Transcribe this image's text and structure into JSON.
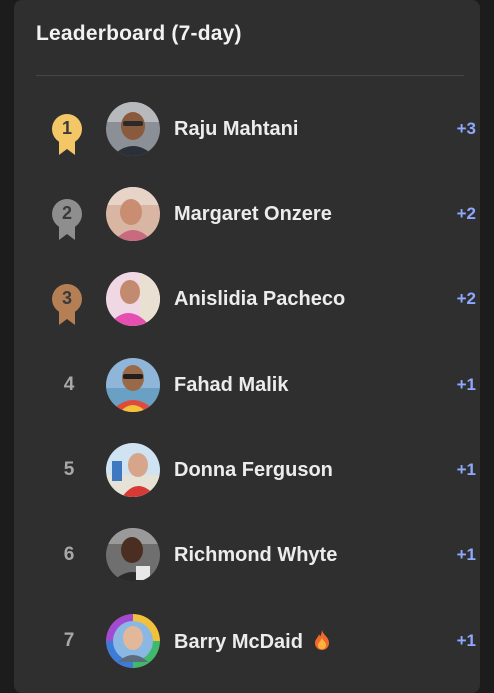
{
  "header": {
    "title": "Leaderboard (7-day)"
  },
  "colors": {
    "gold": "#f3c666",
    "silver": "#8e8e8e",
    "bronze": "#b57f55",
    "score": "#8fa8ff"
  },
  "entries": [
    {
      "rank": "1",
      "name": "Raju Mahtani",
      "score": "+3",
      "medal": "gold",
      "avatar": "avatar-photo"
    },
    {
      "rank": "2",
      "name": "Margaret Onzere",
      "score": "+2",
      "medal": "silver",
      "avatar": "avatar-photo"
    },
    {
      "rank": "3",
      "name": "Anislidia Pacheco",
      "score": "+2",
      "medal": "bronze",
      "avatar": "avatar-photo"
    },
    {
      "rank": "4",
      "name": "Fahad Malik",
      "score": "+1",
      "medal": "",
      "avatar": "avatar-photo"
    },
    {
      "rank": "5",
      "name": "Donna Ferguson",
      "score": "+1",
      "medal": "",
      "avatar": "avatar-photo"
    },
    {
      "rank": "6",
      "name": "Richmond Whyte",
      "score": "+1",
      "medal": "",
      "avatar": "avatar-photo"
    },
    {
      "rank": "7",
      "name": "Barry McDaid",
      "score": "+1",
      "medal": "",
      "avatar": "avatar-photo",
      "badge_icon": "fire-icon"
    }
  ]
}
